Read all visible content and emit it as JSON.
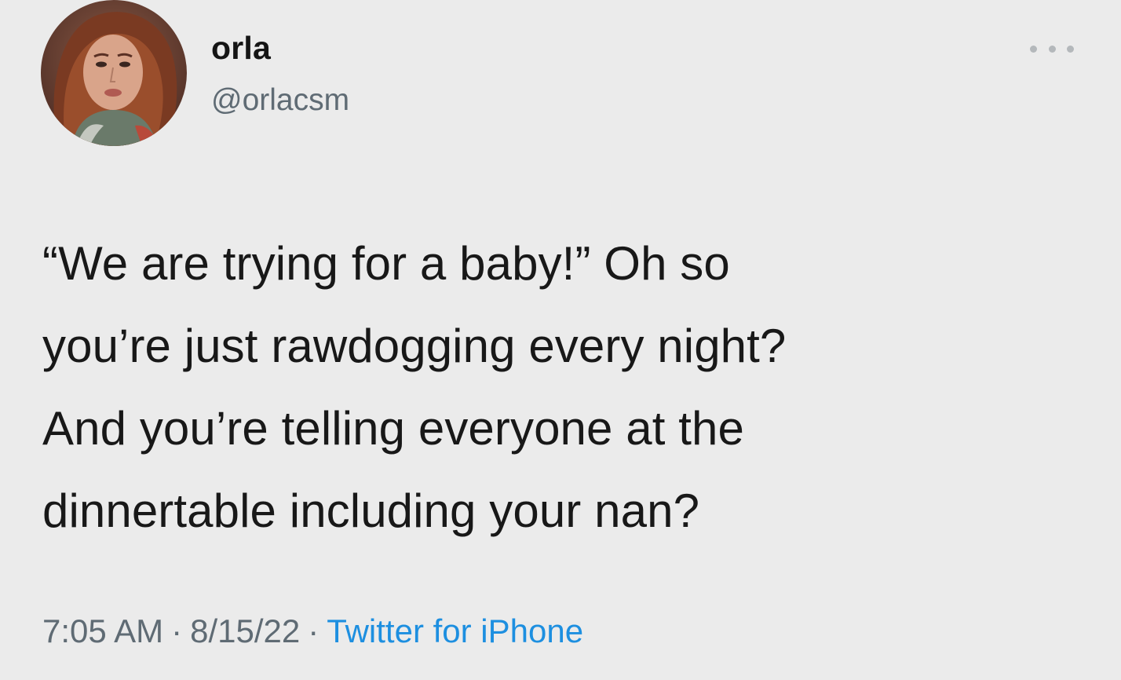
{
  "tweet": {
    "author": {
      "display_name": "orla",
      "handle": "@orlacsm",
      "avatar_icon": "profile-photo"
    },
    "more_icon": "more-options-icon",
    "text": "“We are trying for a baby!” Oh so\nyou’re just rawdogging every night?\nAnd you’re telling everyone at the\ndinnertable including your nan?",
    "time": "7:05 AM",
    "separator": "·",
    "date": "8/15/22",
    "source": "Twitter for iPhone"
  },
  "colors": {
    "background": "#ebebeb",
    "secondary_text": "#5f6b74",
    "link": "#1d8fe0"
  }
}
